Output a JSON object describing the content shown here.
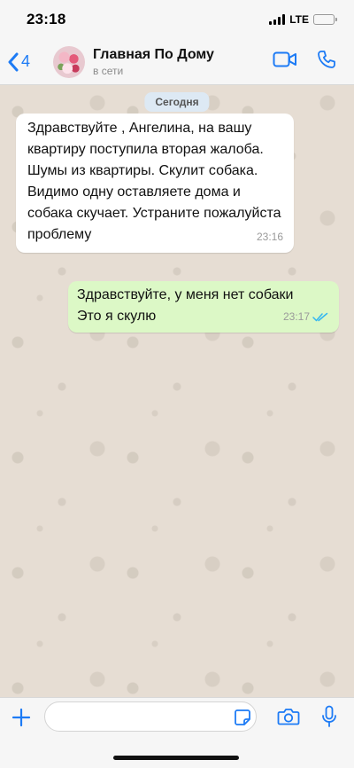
{
  "status_bar": {
    "time": "23:18",
    "network": "LTE"
  },
  "header": {
    "back_count": "4",
    "contact_name": "Главная По Дому",
    "contact_status": "в сети",
    "icons": [
      "chevron-left-icon",
      "video-call-icon",
      "phone-icon"
    ]
  },
  "chat": {
    "date_badge": "Сегодня",
    "messages": [
      {
        "direction": "incoming",
        "text": "Здравствуйте , Ангелина, на вашу квартиру поступила вторая жалоба. Шумы из квартиры. Скулит собака. Видимо одну оставляете дома и собака скучает. Устраните пожалуйста проблему",
        "time": "23:16"
      },
      {
        "direction": "outgoing",
        "text": "Здравствуйте, у меня нет собаки\nЭто я скулю",
        "time": "23:17",
        "status": "read"
      }
    ]
  },
  "input_bar": {
    "placeholder": "",
    "icons": [
      "plus-icon",
      "sticker-icon",
      "camera-icon",
      "microphone-icon"
    ]
  },
  "colors": {
    "accent": "#1d7bf5",
    "incoming_bubble": "#ffffff",
    "outgoing_bubble": "#dcf8c6",
    "read_ticks": "#34b7f1"
  }
}
